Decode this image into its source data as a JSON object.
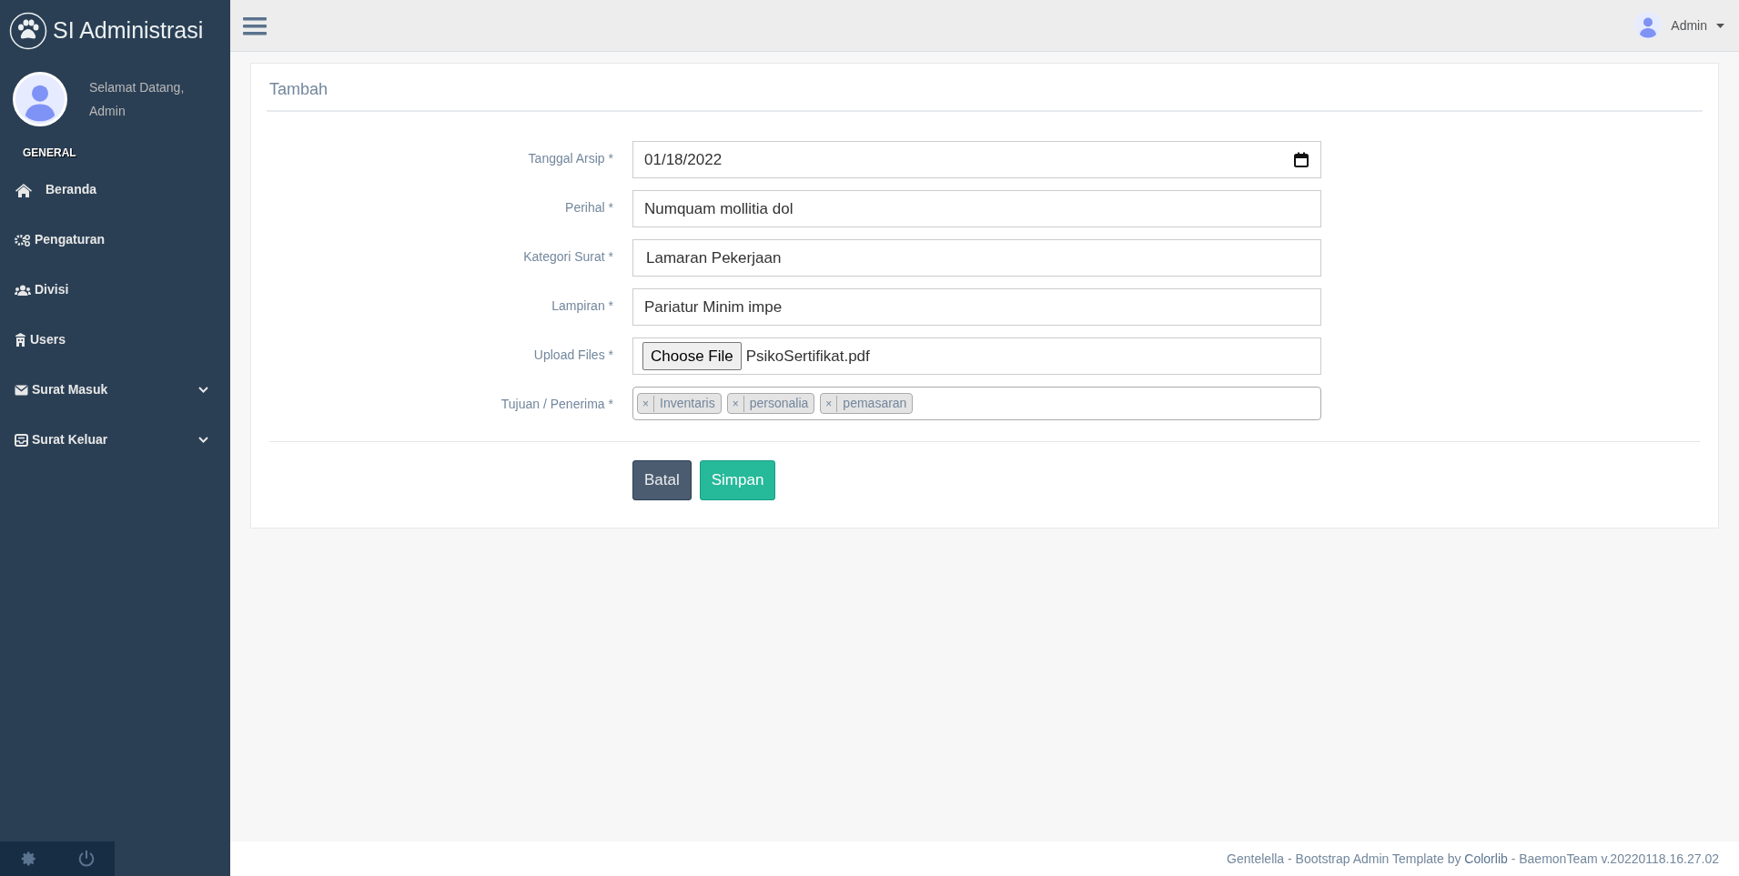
{
  "sidebar": {
    "brand": "SI Administrasi",
    "welcome": "Selamat Datang,",
    "user_name": "Admin",
    "section_title": "GENERAL",
    "items": [
      {
        "label": "Beranda",
        "expandable": false
      },
      {
        "label": "Pengaturan",
        "expandable": false
      },
      {
        "label": "Divisi",
        "expandable": false
      },
      {
        "label": "Users",
        "expandable": false
      },
      {
        "label": "Surat Masuk",
        "expandable": true
      },
      {
        "label": "Surat Keluar",
        "expandable": true
      }
    ]
  },
  "top_nav": {
    "user_name": "Admin"
  },
  "panel": {
    "title": "Tambah",
    "fields": [
      {
        "kind": "date",
        "label": "Tanggal Arsip *",
        "value": "01/18/2022"
      },
      {
        "kind": "text",
        "label": "Perihal *",
        "value": "Numquam mollitia dol"
      },
      {
        "kind": "select",
        "label": "Kategori Surat *",
        "value": "Lamaran Pekerjaan"
      },
      {
        "kind": "text",
        "label": "Lampiran *",
        "value": "Pariatur Minim impe"
      },
      {
        "kind": "file",
        "label": "Upload Files *",
        "button": "Choose File",
        "value": "PsikoSertifikat.pdf"
      },
      {
        "kind": "tags",
        "label": "Tujuan / Penerima *",
        "tags": [
          {
            "remove": "×",
            "label": "Inventaris"
          },
          {
            "remove": "×",
            "label": "personalia"
          },
          {
            "remove": "×",
            "label": "pemasaran"
          }
        ]
      }
    ],
    "buttons": [
      {
        "kind": "secondary",
        "label": "Batal"
      },
      {
        "kind": "primary",
        "label": "Simpan"
      }
    ]
  },
  "footer": {
    "text_before": "Gentelella - Bootstrap Admin Template by ",
    "link": "Colorlib",
    "text_after": " - BaemonTeam v.20220118.16.27.02"
  }
}
